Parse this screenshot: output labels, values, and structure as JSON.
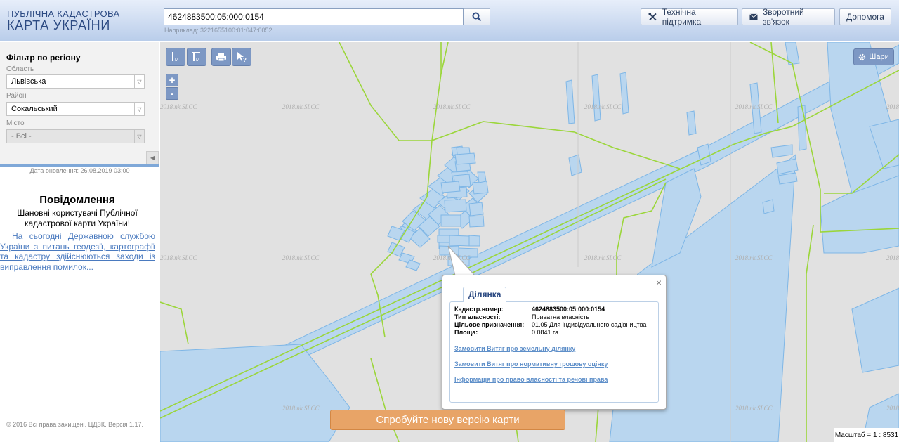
{
  "header": {
    "logo_line1": "ПУБЛІЧНА КАДАСТРОВА",
    "logo_line2": "КАРТА УКРАЇНИ",
    "search_value": "4624883500:05:000:0154",
    "search_hint": "Наприклад: 3221655100:01:047:0052",
    "support_label": "Технічна підтримка",
    "feedback_label": "Зворотний зв'язок",
    "help_label": "Допомога"
  },
  "filter": {
    "title": "Фільтр по регіону",
    "region_label": "Область",
    "region_value": "Львівська",
    "district_label": "Район",
    "district_value": "Сокальський",
    "city_label": "Місто",
    "city_value": "- Всі -"
  },
  "sidebar": {
    "updated": "Дата оновлення: 26.08.2019 03:00",
    "ann_title": "Повідомлення",
    "ann_subtitle": "Шановні користувачі Публічної кадастрової карти України!",
    "ann_link": "На сьогодні Державною службою України з питань геодезії, картографії та кадастру здійснюються заходи із виправлення помилок...",
    "copyright": "© 2016 Всі права захищені. ЦДЗК. Версія 1.17."
  },
  "map": {
    "layers_label": "Шари",
    "watermark": "2018.nk.SLCC",
    "scale": "Масштаб = 1 : 8531",
    "banner": "Спробуйте нову версію карти"
  },
  "popup": {
    "tab": "Ділянка",
    "rows": [
      {
        "key": "Кадастр.номер:",
        "value": "4624883500:05:000:0154"
      },
      {
        "key": "Тип власності:",
        "value": "Приватна власність"
      },
      {
        "key": "Цільове призначення:",
        "value": "01.05 Для індивідуального садівництва"
      },
      {
        "key": "Площа:",
        "value": "0.0841 га"
      }
    ],
    "links": [
      "Замовити Витяг про земельну ділянку",
      "Замовити Витяг про нормативну грошову оцінку",
      "Інформація про право власності та речові права"
    ]
  },
  "colors": {
    "parcel_fill": "#b9d6ef",
    "parcel_stroke": "#7eb6e6",
    "boundary": "#9bd63a",
    "header_text": "#2c4a82"
  }
}
